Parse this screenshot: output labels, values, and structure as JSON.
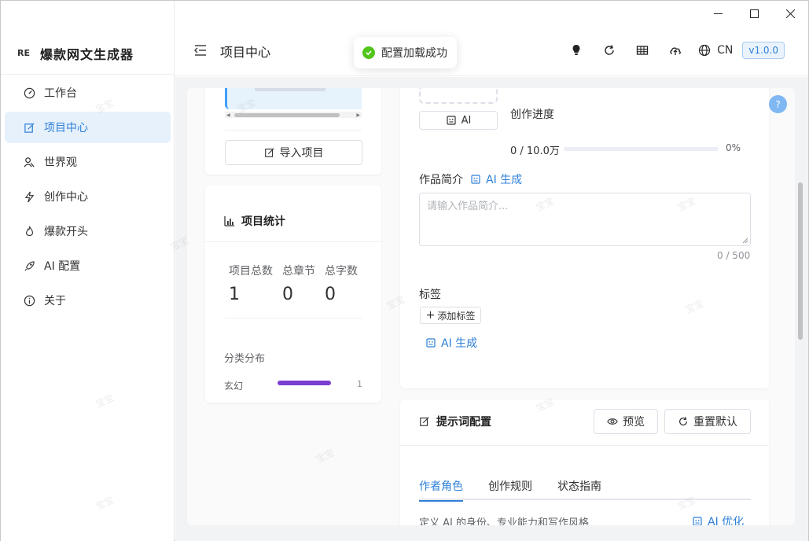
{
  "app": {
    "logo_text": "爆款网文生成器",
    "logo_mark": "RE"
  },
  "sidebar": {
    "items": [
      {
        "label": "工作台",
        "icon": "dashboard-icon"
      },
      {
        "label": "项目中心",
        "icon": "edit-icon",
        "active": true
      },
      {
        "label": "世界观",
        "icon": "people-icon"
      },
      {
        "label": "创作中心",
        "icon": "lightning-icon"
      },
      {
        "label": "爆款开头",
        "icon": "flame-icon"
      },
      {
        "label": "AI 配置",
        "icon": "rocket-icon"
      },
      {
        "label": "关于",
        "icon": "info-icon"
      }
    ]
  },
  "header": {
    "title": "项目中心",
    "lang": "CN",
    "version": "v1.0.0"
  },
  "toast": {
    "message": "配置加载成功"
  },
  "left_panel": {
    "import_button": "导入项目",
    "stats_title": "项目统计",
    "stats": [
      {
        "label": "项目总数",
        "value": "1"
      },
      {
        "label": "总章节",
        "value": "0"
      },
      {
        "label": "总字数",
        "value": "0"
      }
    ],
    "category_title": "分类分布",
    "categories": [
      {
        "name": "玄幻",
        "count": "1",
        "share": 1.0
      }
    ]
  },
  "right_panel": {
    "ai_button": "AI",
    "progress_label": "创作进度",
    "progress_text": "0 / 10.0万",
    "progress_percent": "0%",
    "progress_value": 0,
    "intro_label": "作品简介",
    "ai_generate": "AI 生成",
    "intro_placeholder": "请输入作品简介...",
    "intro_counter": "0 / 500",
    "tags_label": "标签",
    "add_tag": "添加标签",
    "tags_ai_generate": "AI 生成"
  },
  "prompt_config": {
    "title": "提示词配置",
    "preview_button": "预览",
    "reset_button": "重置默认",
    "tabs": [
      "作者角色",
      "创作规则",
      "状态指南"
    ],
    "active_tab": 0,
    "description": "定义 AI 的身份、专业能力和写作风格",
    "ai_optimize": "AI 优化"
  },
  "watermark": "宝宝"
}
